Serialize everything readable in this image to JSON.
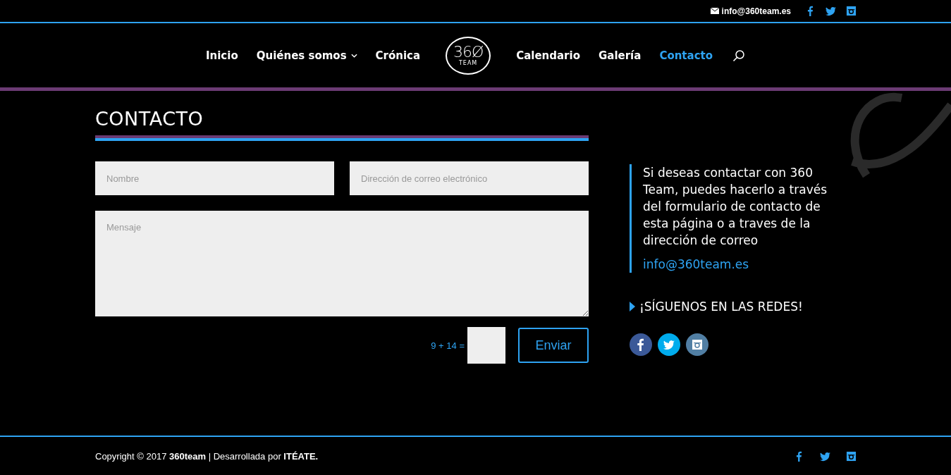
{
  "top_bar": {
    "email": "info@360team.es",
    "social": [
      {
        "kind": "facebook"
      },
      {
        "kind": "twitter"
      },
      {
        "kind": "instagram"
      }
    ]
  },
  "nav": {
    "items": [
      {
        "label": "Inicio",
        "selected": false,
        "dropdown": false
      },
      {
        "label": "Quiénes somos",
        "selected": false,
        "dropdown": true
      },
      {
        "label": "Crónica",
        "selected": false,
        "dropdown": false
      }
    ],
    "logo": {
      "main": "36Ø",
      "sub": "TEAM"
    },
    "items_right": [
      {
        "label": "Calendario",
        "selected": false,
        "dropdown": false
      },
      {
        "label": "Galería",
        "selected": false,
        "dropdown": false
      },
      {
        "label": "Contacto",
        "selected": true,
        "dropdown": false
      }
    ]
  },
  "page_title": "CONTACTO",
  "form": {
    "name_placeholder": "Nombre",
    "email_placeholder": "Dirección de correo electrónico",
    "message_placeholder": "Mensaje",
    "captcha": "9 + 14 =",
    "submit": "Enviar"
  },
  "sidebar": {
    "text": "Si deseas contactar con 360 Team, puedes hacerlo a través del formulario de contacto de esta página o a traves de la dirección de correo",
    "email": "info@360team.es",
    "follow_heading": "¡SÍGUENOS EN LAS REDES!",
    "social": [
      {
        "kind": "facebook",
        "color": "#3b5998"
      },
      {
        "kind": "twitter",
        "color": "#00aced"
      },
      {
        "kind": "instagram",
        "color": "#517fa4"
      }
    ]
  },
  "footer": {
    "copyright": "Copyright © 2017 **360team** | Desarrollada por **ITÉATE.**",
    "social": [
      {
        "kind": "facebook"
      },
      {
        "kind": "twitter"
      },
      {
        "kind": "instagram"
      }
    ]
  }
}
